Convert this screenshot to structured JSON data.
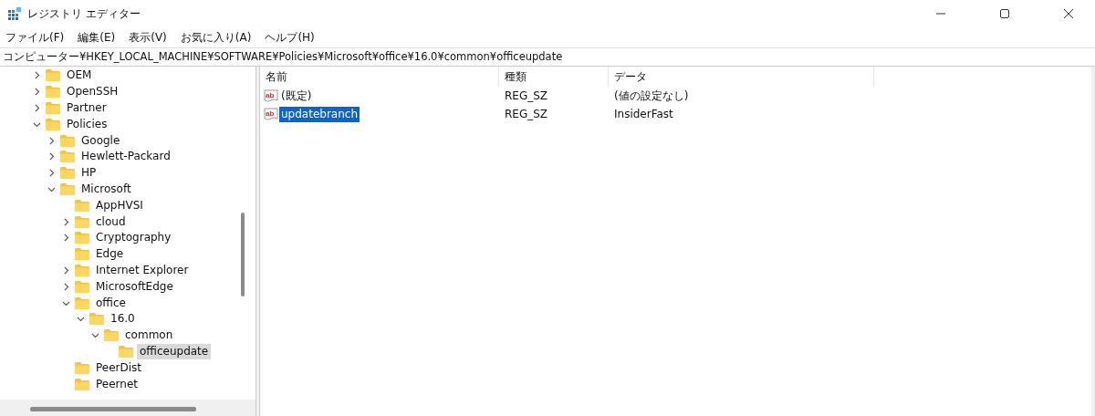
{
  "window": {
    "title": "レジストリ エディター"
  },
  "menu": [
    "ファイル(F)",
    "編集(E)",
    "表示(V)",
    "お気に入り(A)",
    "ヘルプ(H)"
  ],
  "address": "コンピューター¥HKEY_LOCAL_MACHINE¥SOFTWARE¥Policies¥Microsoft¥office¥16.0¥common¥officeupdate",
  "tree": [
    {
      "label": "OEM",
      "expanded": false,
      "selected": false
    },
    {
      "label": "OpenSSH",
      "expanded": false,
      "selected": false
    },
    {
      "label": "Partner",
      "expanded": false,
      "selected": false
    },
    {
      "label": "Policies",
      "expanded": true,
      "selected": false,
      "children": [
        {
          "label": "Google",
          "expanded": false,
          "selected": false
        },
        {
          "label": "Hewlett-Packard",
          "expanded": false,
          "selected": false
        },
        {
          "label": "HP",
          "expanded": false,
          "selected": false
        },
        {
          "label": "Microsoft",
          "expanded": true,
          "selected": false,
          "children": [
            {
              "label": "AppHVSI",
              "selected": false
            },
            {
              "label": "cloud",
              "expanded": false,
              "selected": false
            },
            {
              "label": "Cryptography",
              "expanded": false,
              "selected": false
            },
            {
              "label": "Edge",
              "selected": false
            },
            {
              "label": "Internet Explorer",
              "expanded": false,
              "selected": false
            },
            {
              "label": "MicrosoftEdge",
              "expanded": false,
              "selected": false
            },
            {
              "label": "office",
              "expanded": true,
              "selected": false,
              "children": [
                {
                  "label": "16.0",
                  "expanded": true,
                  "selected": false,
                  "children": [
                    {
                      "label": "common",
                      "expanded": true,
                      "selected": false,
                      "children": [
                        {
                          "label": "officeupdate",
                          "selected": true
                        }
                      ]
                    }
                  ]
                }
              ]
            },
            {
              "label": "PeerDist",
              "selected": false
            },
            {
              "label": "Peernet",
              "selected": false
            }
          ]
        }
      ]
    }
  ],
  "table": {
    "columns": [
      "名前",
      "種類",
      "データ"
    ],
    "rows": [
      {
        "icon": "ab",
        "name": "(既定)",
        "type": "REG_SZ",
        "data": "(値の設定なし)",
        "selected": false
      },
      {
        "icon": "ab",
        "name": "updatebranch",
        "type": "REG_SZ",
        "data": "InsiderFast",
        "selected": true
      }
    ]
  }
}
